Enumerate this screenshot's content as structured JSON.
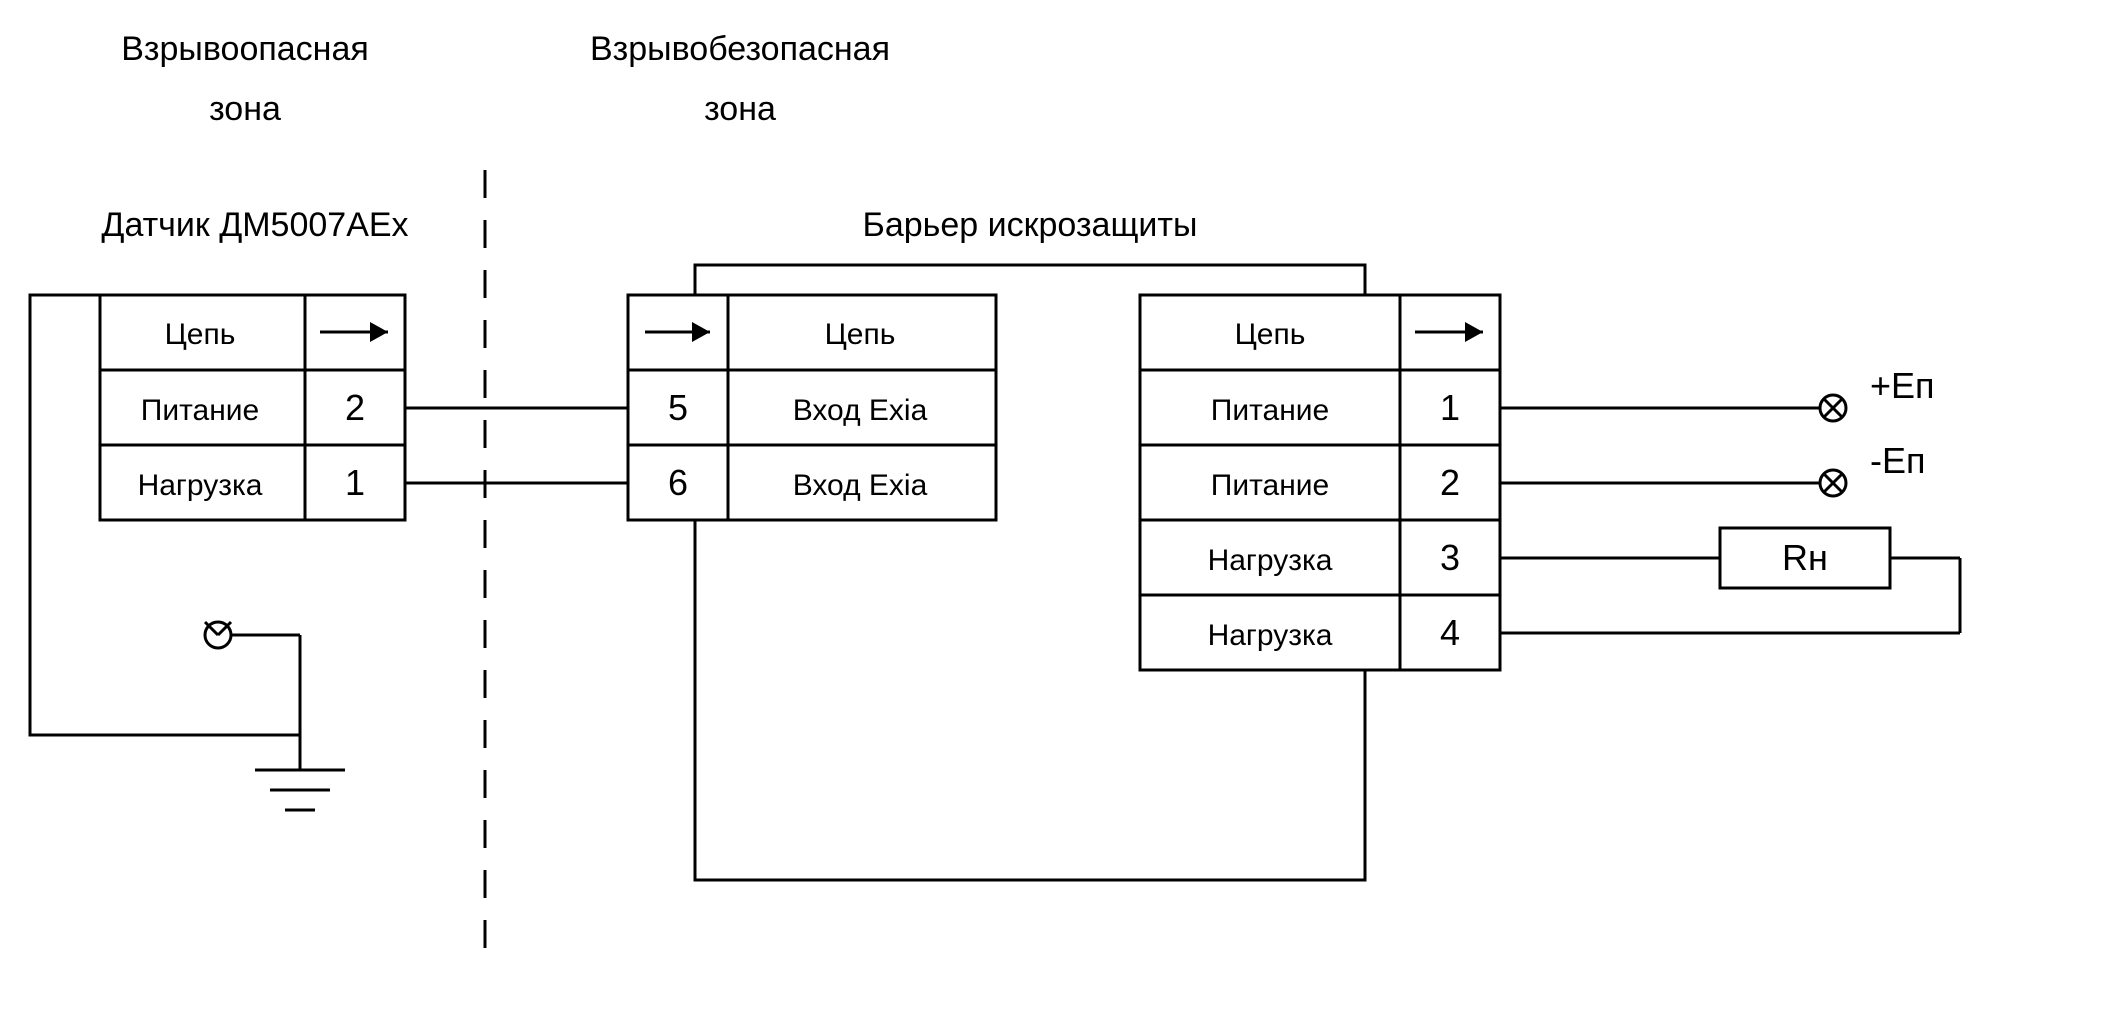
{
  "zones": {
    "hazardous": {
      "line1": "Взрывоопасная",
      "line2": "зона"
    },
    "safe": {
      "line1": "Взрывобезопасная",
      "line2": "зона"
    }
  },
  "sensor": {
    "title": "Датчик ДМ5007АЕх",
    "header": "Цепь",
    "rows": [
      {
        "name": "Питание",
        "pin": "2"
      },
      {
        "name": "Нагрузка",
        "pin": "1"
      }
    ]
  },
  "barrier": {
    "title": "Барьер искрозащиты",
    "left": {
      "header": "Цепь",
      "rows": [
        {
          "pin": "5",
          "name": "Вход Exia"
        },
        {
          "pin": "6",
          "name": "Вход Exia"
        }
      ]
    },
    "right": {
      "header": "Цепь",
      "rows": [
        {
          "name": "Питание",
          "pin": "1"
        },
        {
          "name": "Питание",
          "pin": "2"
        },
        {
          "name": "Нагрузка",
          "pin": "3"
        },
        {
          "name": "Нагрузка",
          "pin": "4"
        }
      ]
    }
  },
  "terminals": {
    "pos": "+Еп",
    "neg": "-Еп",
    "load": "Rн"
  }
}
